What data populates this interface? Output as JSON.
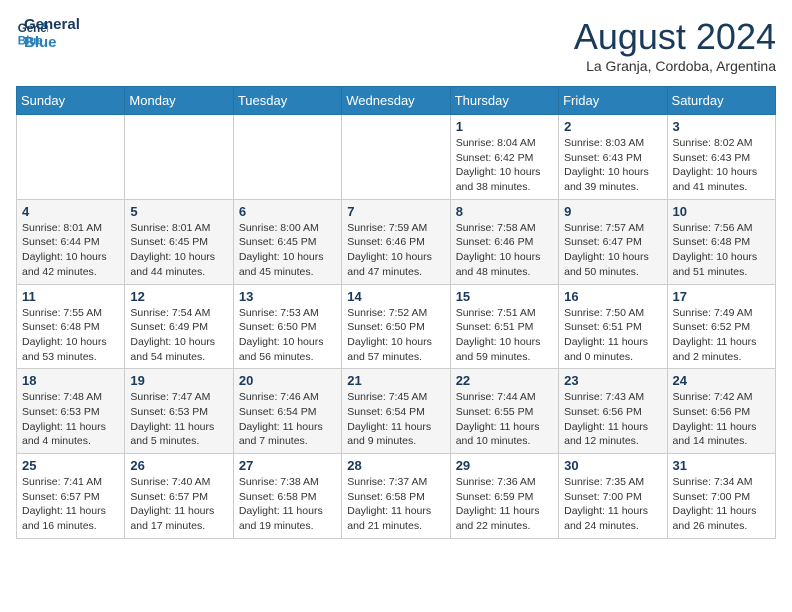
{
  "header": {
    "logo_line1": "General",
    "logo_line2": "Blue",
    "month_year": "August 2024",
    "location": "La Granja, Cordoba, Argentina"
  },
  "days_of_week": [
    "Sunday",
    "Monday",
    "Tuesday",
    "Wednesday",
    "Thursday",
    "Friday",
    "Saturday"
  ],
  "weeks": [
    [
      {
        "day": "",
        "info": ""
      },
      {
        "day": "",
        "info": ""
      },
      {
        "day": "",
        "info": ""
      },
      {
        "day": "",
        "info": ""
      },
      {
        "day": "1",
        "info": "Sunrise: 8:04 AM\nSunset: 6:42 PM\nDaylight: 10 hours\nand 38 minutes."
      },
      {
        "day": "2",
        "info": "Sunrise: 8:03 AM\nSunset: 6:43 PM\nDaylight: 10 hours\nand 39 minutes."
      },
      {
        "day": "3",
        "info": "Sunrise: 8:02 AM\nSunset: 6:43 PM\nDaylight: 10 hours\nand 41 minutes."
      }
    ],
    [
      {
        "day": "4",
        "info": "Sunrise: 8:01 AM\nSunset: 6:44 PM\nDaylight: 10 hours\nand 42 minutes."
      },
      {
        "day": "5",
        "info": "Sunrise: 8:01 AM\nSunset: 6:45 PM\nDaylight: 10 hours\nand 44 minutes."
      },
      {
        "day": "6",
        "info": "Sunrise: 8:00 AM\nSunset: 6:45 PM\nDaylight: 10 hours\nand 45 minutes."
      },
      {
        "day": "7",
        "info": "Sunrise: 7:59 AM\nSunset: 6:46 PM\nDaylight: 10 hours\nand 47 minutes."
      },
      {
        "day": "8",
        "info": "Sunrise: 7:58 AM\nSunset: 6:46 PM\nDaylight: 10 hours\nand 48 minutes."
      },
      {
        "day": "9",
        "info": "Sunrise: 7:57 AM\nSunset: 6:47 PM\nDaylight: 10 hours\nand 50 minutes."
      },
      {
        "day": "10",
        "info": "Sunrise: 7:56 AM\nSunset: 6:48 PM\nDaylight: 10 hours\nand 51 minutes."
      }
    ],
    [
      {
        "day": "11",
        "info": "Sunrise: 7:55 AM\nSunset: 6:48 PM\nDaylight: 10 hours\nand 53 minutes."
      },
      {
        "day": "12",
        "info": "Sunrise: 7:54 AM\nSunset: 6:49 PM\nDaylight: 10 hours\nand 54 minutes."
      },
      {
        "day": "13",
        "info": "Sunrise: 7:53 AM\nSunset: 6:50 PM\nDaylight: 10 hours\nand 56 minutes."
      },
      {
        "day": "14",
        "info": "Sunrise: 7:52 AM\nSunset: 6:50 PM\nDaylight: 10 hours\nand 57 minutes."
      },
      {
        "day": "15",
        "info": "Sunrise: 7:51 AM\nSunset: 6:51 PM\nDaylight: 10 hours\nand 59 minutes."
      },
      {
        "day": "16",
        "info": "Sunrise: 7:50 AM\nSunset: 6:51 PM\nDaylight: 11 hours\nand 0 minutes."
      },
      {
        "day": "17",
        "info": "Sunrise: 7:49 AM\nSunset: 6:52 PM\nDaylight: 11 hours\nand 2 minutes."
      }
    ],
    [
      {
        "day": "18",
        "info": "Sunrise: 7:48 AM\nSunset: 6:53 PM\nDaylight: 11 hours\nand 4 minutes."
      },
      {
        "day": "19",
        "info": "Sunrise: 7:47 AM\nSunset: 6:53 PM\nDaylight: 11 hours\nand 5 minutes."
      },
      {
        "day": "20",
        "info": "Sunrise: 7:46 AM\nSunset: 6:54 PM\nDaylight: 11 hours\nand 7 minutes."
      },
      {
        "day": "21",
        "info": "Sunrise: 7:45 AM\nSunset: 6:54 PM\nDaylight: 11 hours\nand 9 minutes."
      },
      {
        "day": "22",
        "info": "Sunrise: 7:44 AM\nSunset: 6:55 PM\nDaylight: 11 hours\nand 10 minutes."
      },
      {
        "day": "23",
        "info": "Sunrise: 7:43 AM\nSunset: 6:56 PM\nDaylight: 11 hours\nand 12 minutes."
      },
      {
        "day": "24",
        "info": "Sunrise: 7:42 AM\nSunset: 6:56 PM\nDaylight: 11 hours\nand 14 minutes."
      }
    ],
    [
      {
        "day": "25",
        "info": "Sunrise: 7:41 AM\nSunset: 6:57 PM\nDaylight: 11 hours\nand 16 minutes."
      },
      {
        "day": "26",
        "info": "Sunrise: 7:40 AM\nSunset: 6:57 PM\nDaylight: 11 hours\nand 17 minutes."
      },
      {
        "day": "27",
        "info": "Sunrise: 7:38 AM\nSunset: 6:58 PM\nDaylight: 11 hours\nand 19 minutes."
      },
      {
        "day": "28",
        "info": "Sunrise: 7:37 AM\nSunset: 6:58 PM\nDaylight: 11 hours\nand 21 minutes."
      },
      {
        "day": "29",
        "info": "Sunrise: 7:36 AM\nSunset: 6:59 PM\nDaylight: 11 hours\nand 22 minutes."
      },
      {
        "day": "30",
        "info": "Sunrise: 7:35 AM\nSunset: 7:00 PM\nDaylight: 11 hours\nand 24 minutes."
      },
      {
        "day": "31",
        "info": "Sunrise: 7:34 AM\nSunset: 7:00 PM\nDaylight: 11 hours\nand 26 minutes."
      }
    ]
  ]
}
